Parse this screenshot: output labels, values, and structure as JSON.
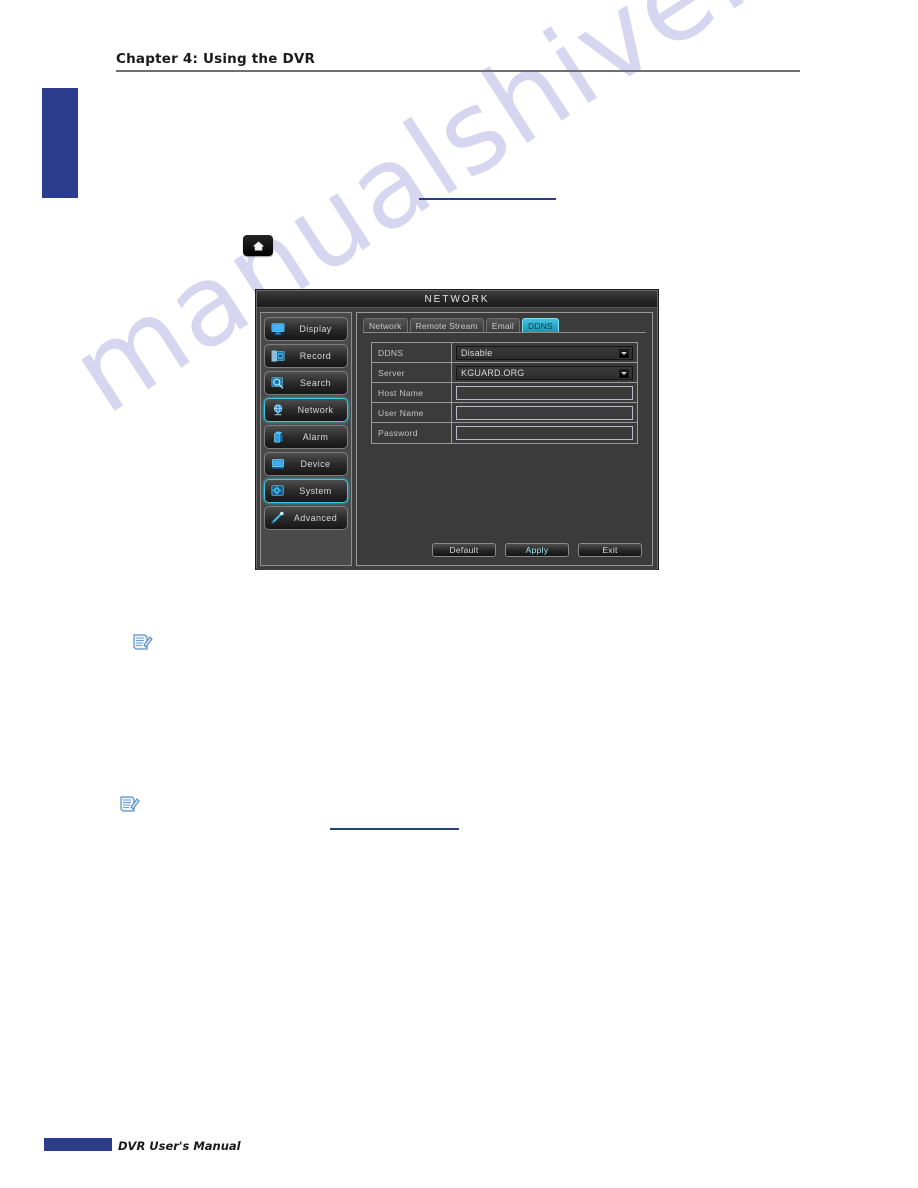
{
  "page": {
    "chapter_heading": "Chapter 4: Using the DVR",
    "footer_label": "DVR User's Manual",
    "watermark": "manualshive.com"
  },
  "home_button": {
    "icon": "home-icon"
  },
  "notes": [
    {
      "icon": "note-pencil-icon"
    },
    {
      "icon": "note-pencil-icon"
    }
  ],
  "dialog": {
    "title": "NETWORK",
    "sidebar": {
      "items": [
        {
          "label": "Display",
          "icon": "monitor-icon",
          "selected": false
        },
        {
          "label": "Record",
          "icon": "record-icon",
          "selected": false
        },
        {
          "label": "Search",
          "icon": "magnifier-icon",
          "selected": false
        },
        {
          "label": "Network",
          "icon": "globe-icon",
          "selected": true
        },
        {
          "label": "Alarm",
          "icon": "alarm-icon",
          "selected": false
        },
        {
          "label": "Device",
          "icon": "device-icon",
          "selected": false
        },
        {
          "label": "System",
          "icon": "gear-icon",
          "selected": true
        },
        {
          "label": "Advanced",
          "icon": "wrench-icon",
          "selected": false
        }
      ]
    },
    "tabs": [
      {
        "label": "Network",
        "active": false
      },
      {
        "label": "Remote Stream",
        "active": false
      },
      {
        "label": "Email",
        "active": false
      },
      {
        "label": "DDNS",
        "active": true
      }
    ],
    "form": {
      "rows": [
        {
          "name": "DDNS",
          "type": "select",
          "value": "Disable"
        },
        {
          "name": "Server",
          "type": "select",
          "value": "KGUARD.ORG"
        },
        {
          "name": "Host Name",
          "type": "text",
          "value": ""
        },
        {
          "name": "User Name",
          "type": "text",
          "value": ""
        },
        {
          "name": "Password",
          "type": "password",
          "value": ""
        }
      ]
    },
    "buttons": [
      {
        "label": "Default",
        "accent": false
      },
      {
        "label": "Apply",
        "accent": true
      },
      {
        "label": "Exit",
        "accent": false
      }
    ]
  },
  "colors": {
    "accent_cyan": "#3fc3e0",
    "brand_blue": "#2b3d8c",
    "link_blue": "#27407e",
    "watermark": "#cfcfee"
  }
}
